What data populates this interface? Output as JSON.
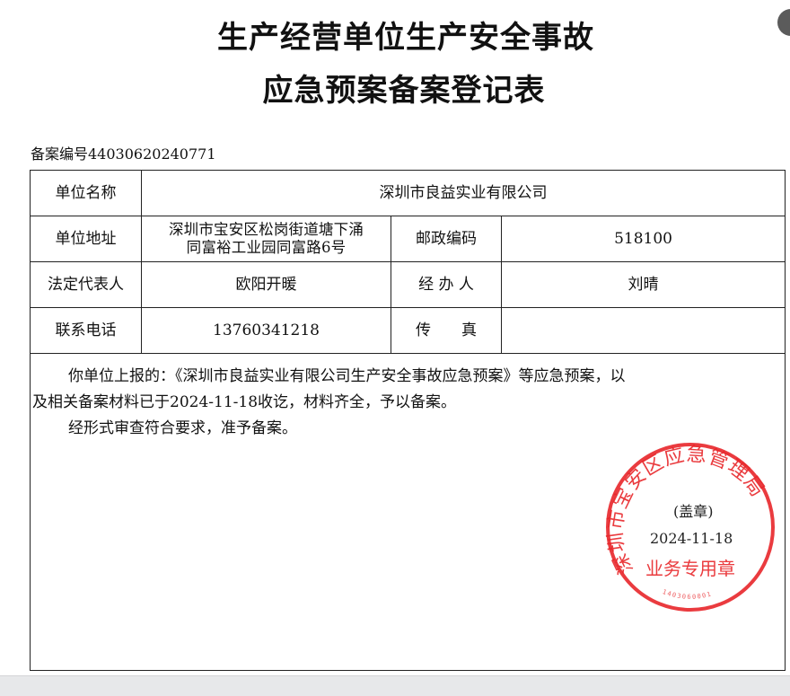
{
  "document": {
    "title_line1": "生产经营单位生产安全事故",
    "title_line2": "应急预案备案登记表",
    "record_number": "备案编号44030620240771"
  },
  "form": {
    "unit_name_label": "单位名称",
    "unit_name_value": "深圳市良益实业有限公司",
    "unit_address_label": "单位地址",
    "unit_address_line1": "深圳市宝安区松岗街道塘下涌",
    "unit_address_line2": "同富裕工业园同富路6号",
    "postal_code_label": "邮政编码",
    "postal_code_value": "518100",
    "legal_rep_label": "法定代表人",
    "legal_rep_value": "欧阳开暖",
    "handler_label": "经 办 人",
    "handler_value": "刘晴",
    "phone_label": "联系电话",
    "phone_value": "13760341218",
    "fax_label": "传　　真",
    "fax_value": ""
  },
  "body": {
    "paragraph1_line1": "你单位上报的：《深圳市良益实业有限公司生产安全事故应急预案》等应急预案，以",
    "paragraph1_line2": "及相关备案材料已于2024-11-18收讫，材料齐全，予以备案。",
    "paragraph2": "经形式审查符合要求，准予备案。",
    "seal_note": "(盖章)",
    "seal_date": "2024-11-18"
  },
  "stamp": {
    "top_arc_text": "深圳市宝安区应急管理局",
    "bottom_text": "业务专用章",
    "serial": "1403060001",
    "color": "#e8262a"
  }
}
